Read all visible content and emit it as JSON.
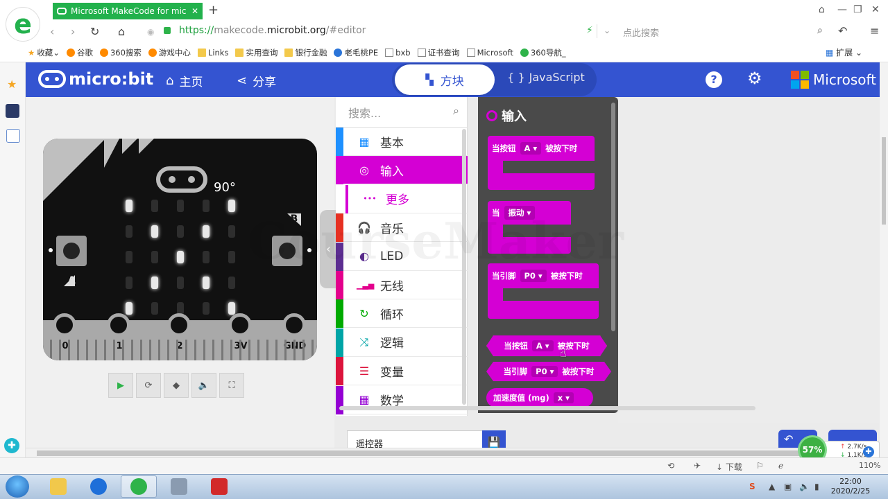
{
  "browser": {
    "tab_title": "Microsoft MakeCode for mic",
    "tab_close": "✕",
    "new_tab": "+",
    "url_scheme": "https://",
    "url_host_prefix": "makecode.",
    "url_host": "microbit.org",
    "url_path": "/#editor",
    "search_placeholder": "点此搜索",
    "bookmarks": [
      {
        "label": "收藏",
        "icon": "star-icon"
      },
      {
        "label": "谷歌",
        "icon": "orange"
      },
      {
        "label": "360搜索",
        "icon": "orange"
      },
      {
        "label": "游戏中心",
        "icon": "orange"
      },
      {
        "label": "Links",
        "icon": "folder"
      },
      {
        "label": "实用查询",
        "icon": "folder"
      },
      {
        "label": "银行金融",
        "icon": "folder"
      },
      {
        "label": "老毛桃PE",
        "icon": "blue"
      },
      {
        "label": "bxb",
        "icon": "doc"
      },
      {
        "label": "证书查询",
        "icon": "doc"
      },
      {
        "label": "Microsoft",
        "icon": "doc"
      },
      {
        "label": "360导航_",
        "icon": "green"
      }
    ],
    "extensions_label": "扩展"
  },
  "header": {
    "logo": "micro:bit",
    "home": "主页",
    "share": "分享",
    "blocks_tab": "方块",
    "js_tab": "JavaScript",
    "microsoft": "Microsoft"
  },
  "simulator": {
    "compass": "90°",
    "button_a": "A",
    "button_b": "B",
    "pins": [
      "0",
      "1",
      "2",
      "3V",
      "GND"
    ],
    "leds": [
      [
        1,
        0,
        0,
        0,
        1
      ],
      [
        0,
        1,
        0,
        1,
        0
      ],
      [
        0,
        0,
        1,
        0,
        0
      ],
      [
        0,
        1,
        0,
        1,
        0
      ],
      [
        1,
        0,
        0,
        0,
        1
      ]
    ],
    "download": "下载"
  },
  "toolbox": {
    "search_placeholder": "搜索...",
    "categories": [
      {
        "label": "基本",
        "color": "#1e90ff",
        "icon": "grid-icon"
      },
      {
        "label": "输入",
        "color": "#d400d4",
        "icon": "target-icon",
        "selected": true
      },
      {
        "label": "更多",
        "color": "#d400d4",
        "icon": "more-icon",
        "sub": true
      },
      {
        "label": "音乐",
        "color": "#e63022",
        "icon": "headphones-icon"
      },
      {
        "label": "LED",
        "color": "#5c2d91",
        "icon": "toggle-icon"
      },
      {
        "label": "无线",
        "color": "#e3008c",
        "icon": "signal-icon"
      },
      {
        "label": "循环",
        "color": "#00aa00",
        "icon": "loop-icon"
      },
      {
        "label": "逻辑",
        "color": "#00a4a6",
        "icon": "shuffle-icon"
      },
      {
        "label": "变量",
        "color": "#dc143c",
        "icon": "list-icon"
      },
      {
        "label": "数学",
        "color": "#9400d3",
        "icon": "calculator-icon"
      }
    ]
  },
  "flyout": {
    "title": "输入",
    "blocks": {
      "b1_pre": "当按钮",
      "b1_dd": "A ▾",
      "b1_post": "被按下时",
      "b2_pre": "当",
      "b2_dd": "振动 ▾",
      "b3_pre": "当引脚",
      "b3_dd": "P0 ▾",
      "b3_post": "被按下时",
      "b4_pre": "当按钮",
      "b4_dd": "A ▾",
      "b4_post": "被按下时",
      "b5_pre": "当引脚",
      "b5_dd": "P0 ▾",
      "b5_post": "被按下时",
      "b6_pre": "加速度值 (mg)",
      "b6_dd": "x ▾"
    }
  },
  "workspace": {
    "project_name": "遥控器"
  },
  "network": {
    "percent": "57%",
    "up": "2.7K/s",
    "down": "1.1K/s"
  },
  "statusbar": {
    "download": "下载",
    "zoom": "110%"
  },
  "taskbar": {
    "time": "22:00",
    "date": "2020/2/25"
  },
  "watermark": "CourseMaker"
}
